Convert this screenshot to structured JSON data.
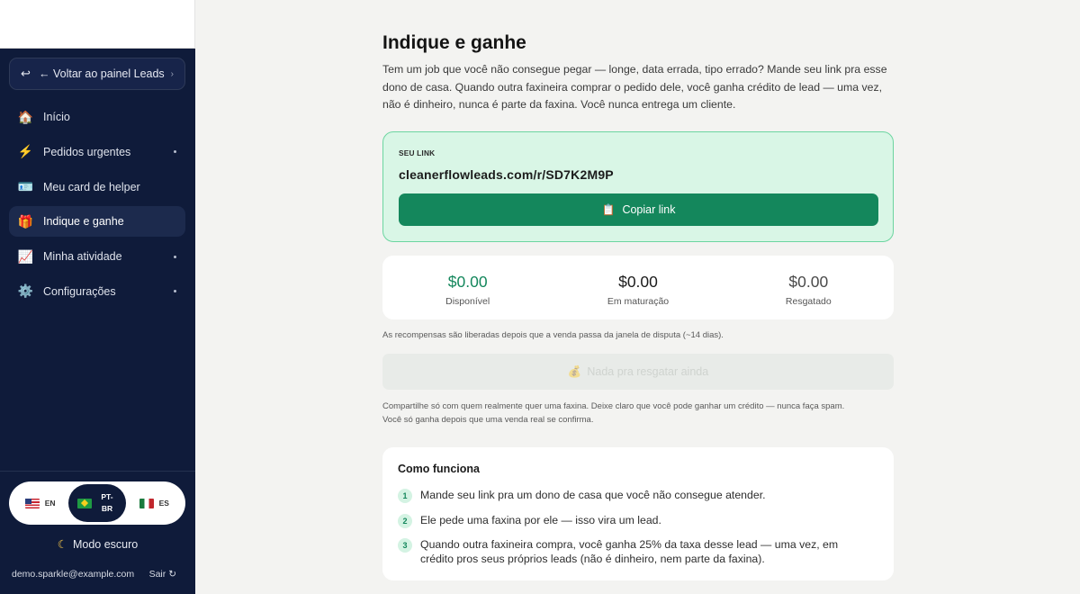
{
  "sidebar": {
    "back": {
      "label": "← Voltar ao painel Leads"
    },
    "items": [
      {
        "label": "Início",
        "icon": "🏠",
        "icon_name": "house-icon",
        "active": false,
        "has_submenu": false
      },
      {
        "label": "Pedidos urgentes",
        "icon": "⚡",
        "icon_name": "lightning-icon",
        "active": false,
        "has_submenu": true
      },
      {
        "label": "Meu card de helper",
        "icon": "🪪",
        "icon_name": "id-card-icon",
        "active": false,
        "has_submenu": false
      },
      {
        "label": "Indique e ganhe",
        "icon": "🎁",
        "icon_name": "gift-icon",
        "active": true,
        "has_submenu": false
      },
      {
        "label": "Minha atividade",
        "icon": "📈",
        "icon_name": "chart-icon",
        "active": false,
        "has_submenu": true
      },
      {
        "label": "Configurações",
        "icon": "⚙️",
        "icon_name": "gear-icon",
        "active": false,
        "has_submenu": true
      }
    ],
    "languages": [
      {
        "code": "EN",
        "flag": "us-flag-icon",
        "active": false
      },
      {
        "code": "PT-BR",
        "flag": "br-flag-icon",
        "active": true
      },
      {
        "code": "ES",
        "flag": "mx-flag-icon",
        "active": false
      }
    ],
    "dark_mode": {
      "label": "Modo escuro"
    },
    "user": {
      "email": "demo.sparkle@example.com",
      "logout": "Sair"
    }
  },
  "main": {
    "title": "Indique e ganhe",
    "intro": "Tem um job que você não consegue pegar — longe, data errada, tipo errado? Mande seu link pra esse dono de casa. Quando outra faxineira comprar o pedido dele, você ganha crédito de lead — uma vez, não é dinheiro, nunca é parte da faxina. Você nunca entrega um cliente.",
    "link_card": {
      "label": "SEU LINK",
      "url": "cleanerflowleads.com/r/SD7K2M9P",
      "copy_button": "Copiar link"
    },
    "stats": [
      {
        "value": "$0.00",
        "label": "Disponível"
      },
      {
        "value": "$0.00",
        "label": "Em maturação"
      },
      {
        "value": "$0.00",
        "label": "Resgatado"
      }
    ],
    "release_note": "As recompensas são liberadas depois que a venda passa da janela de disputa (~14 dias).",
    "redeem_button": "Nada pra resgatar ainda",
    "share_note_1": "Compartilhe só com quem realmente quer uma faxina. Deixe claro que você pode ganhar um crédito — nunca faça spam.",
    "share_note_2": "Você só ganha depois que uma venda real se confirma.",
    "how_it_works": {
      "title": "Como funciona",
      "steps": [
        {
          "n": "1",
          "text": "Mande seu link pra um dono de casa que você não consegue atender."
        },
        {
          "n": "2",
          "text": "Ele pede uma faxina por ele — isso vira um lead."
        },
        {
          "n": "3",
          "text": "Quando outra faxineira compra, você ganha 25% da taxa desse lead — uma vez, em crédito pros seus próprios leads (não é dinheiro, nem parte da faxina)."
        }
      ]
    }
  },
  "colors": {
    "sidebar_bg": "#0f1b3a",
    "accent_green": "#14875c",
    "link_card_bg": "#d9f6e6",
    "link_card_border": "#6cd5a0",
    "page_bg": "#f3f3f1"
  }
}
